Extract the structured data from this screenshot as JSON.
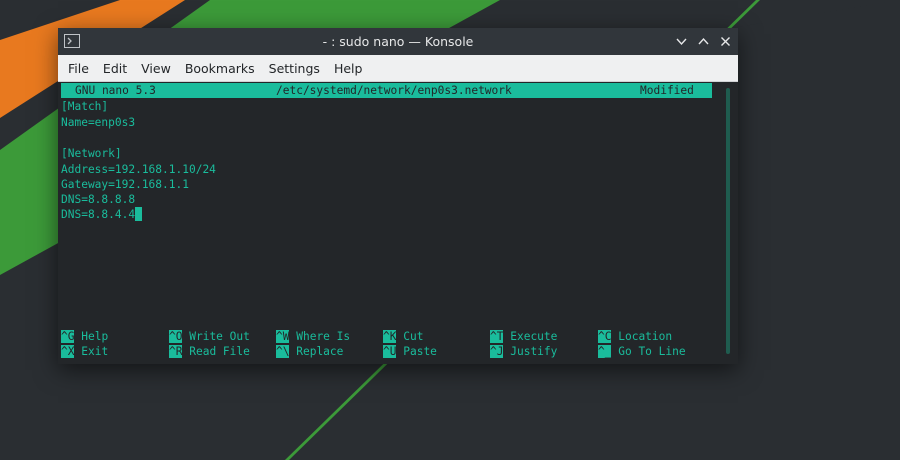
{
  "window": {
    "title": "- : sudo nano — Konsole"
  },
  "menu": [
    "File",
    "Edit",
    "View",
    "Bookmarks",
    "Settings",
    "Help"
  ],
  "nano": {
    "version": "GNU nano 5.3",
    "filename": "/etc/systemd/network/enp0s3.network",
    "status": "Modified"
  },
  "file_lines": [
    "[Match]",
    "Name=enp0s3",
    "",
    "[Network]",
    "Address=192.168.1.10/24",
    "Gateway=192.168.1.1",
    "DNS=8.8.8.8",
    "DNS=8.8.4.4"
  ],
  "shortcuts": [
    {
      "key": "^G",
      "label": "Help"
    },
    {
      "key": "^O",
      "label": "Write Out"
    },
    {
      "key": "^W",
      "label": "Where Is"
    },
    {
      "key": "^K",
      "label": "Cut"
    },
    {
      "key": "^T",
      "label": "Execute"
    },
    {
      "key": "^C",
      "label": "Location"
    },
    {
      "key": "^X",
      "label": "Exit"
    },
    {
      "key": "^R",
      "label": "Read File"
    },
    {
      "key": "^\\",
      "label": "Replace"
    },
    {
      "key": "^U",
      "label": "Paste"
    },
    {
      "key": "^J",
      "label": "Justify"
    },
    {
      "key": "^_",
      "label": "Go To Line"
    }
  ],
  "colors": {
    "accent": "#1abc9c",
    "terminal_bg": "#232629",
    "wallpaper_orange": "#e8791f",
    "wallpaper_green": "#3c9a39"
  },
  "icons": {
    "app": "konsole-terminal-icon",
    "minimize": "chevron-down-icon",
    "maximize": "chevron-up-icon",
    "close": "close-icon"
  }
}
